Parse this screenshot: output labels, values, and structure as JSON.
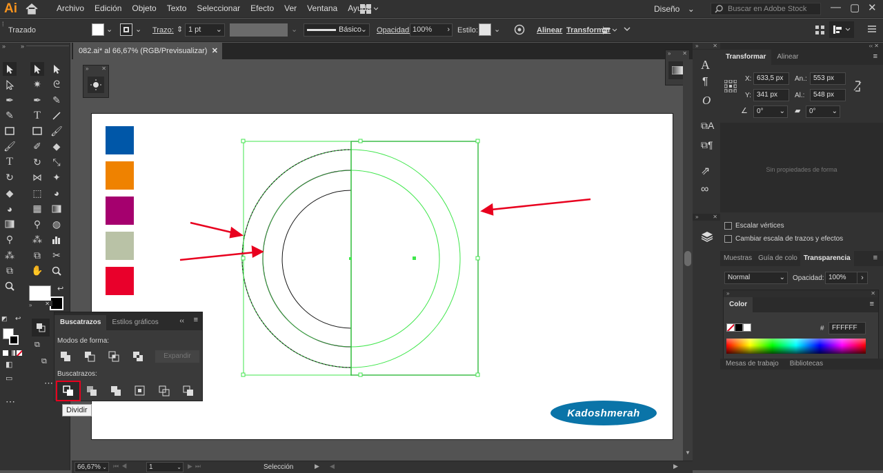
{
  "app": {
    "logo": "Ai"
  },
  "menu": [
    "Archivo",
    "Edición",
    "Objeto",
    "Texto",
    "Seleccionar",
    "Efecto",
    "Ver",
    "Ventana",
    "Ayuda"
  ],
  "workspace": {
    "label": "Diseño"
  },
  "search": {
    "placeholder": "Buscar en Adobe Stock"
  },
  "control": {
    "selection_label": "Trazado",
    "stroke_label": "Trazo:",
    "stroke_weight": "1 pt",
    "brush_label": "Básico",
    "opacity_label": "Opacidad:",
    "opacity_value": "100%",
    "style_label": "Estilo:",
    "align_label": "Alinear",
    "transform_label": "Transformar"
  },
  "document": {
    "tab_title": "082.ai* al 66,67% (RGB/Previsualizar)",
    "watermark": "Kadoshmerah"
  },
  "swatches": [
    "#0057a8",
    "#ef8200",
    "#a5006e",
    "#b9c2a6",
    "#e9002b"
  ],
  "colors": {
    "accent_red": "#e8001e",
    "selection_green": "#3fe64b",
    "ui_dark": "#323232"
  },
  "transform_panel": {
    "tabs": [
      "Transformar",
      "Alinear"
    ],
    "x_label": "X:",
    "x_value": "633,5 px",
    "y_label": "Y:",
    "y_value": "341 px",
    "w_label": "An.:",
    "w_value": "553 px",
    "h_label": "Al.:",
    "h_value": "548 px",
    "angle_value": "0°",
    "shear_value": "0°",
    "shape_props": "Sin propiedades de forma",
    "scale_corners": "Escalar vértices",
    "scale_strokes": "Cambiar escala de trazos y efectos"
  },
  "transparency_panel": {
    "tabs": [
      "Muestras",
      "Guía de colo",
      "Transparencia"
    ],
    "mode": "Normal",
    "opacity_label": "Opacidad:",
    "opacity_value": "100%"
  },
  "color_panel": {
    "tab": "Color",
    "hex_label": "#",
    "hex_value": "FFFFFF"
  },
  "bottom_tabs": [
    "Mesas de trabajo",
    "Bibliotecas"
  ],
  "pathfinder": {
    "tabs": [
      "Buscatrazos",
      "Estilos gráficos"
    ],
    "shape_modes_label": "Modos de forma:",
    "expand_label": "Expandir",
    "pathfinders_label": "Buscatrazos:",
    "tooltip": "Dividir"
  },
  "status": {
    "zoom": "66,67%",
    "page": "1",
    "tool": "Selección"
  }
}
